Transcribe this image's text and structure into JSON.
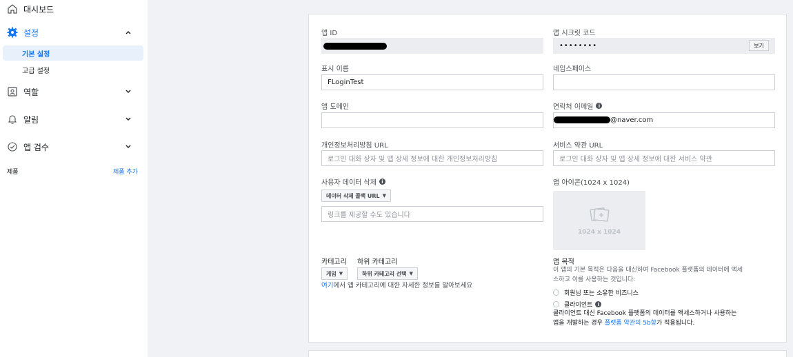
{
  "sidebar": {
    "dashboard": "대시보드",
    "settings": "설정",
    "settings_sub": {
      "basic": "기본 설정",
      "advanced": "고급 설정"
    },
    "roles": "역할",
    "alerts": "알림",
    "app_review": "앱 검수",
    "products_label": "제품",
    "add_product": "제품 추가"
  },
  "form": {
    "app_id_label": "앱 ID",
    "app_secret_label": "앱 시크릿 코드",
    "app_secret_value": "••••••••",
    "show_button": "보기",
    "display_name_label": "표시 이름",
    "display_name_value": "FLoginTest",
    "namespace_label": "네임스페이스",
    "namespace_value": "",
    "app_domain_label": "앱 도메인",
    "app_domain_value": "",
    "contact_email_label": "연락처 이메일",
    "contact_email_suffix": "@naver.com",
    "privacy_url_label": "개인정보처리방침 URL",
    "privacy_url_placeholder": "로그인 대화 상자 및 앱 상세 정보에 대한 개인정보처리방침",
    "tos_url_label": "서비스 약관 URL",
    "tos_url_placeholder": "로그인 대화 상자 및 앱 상세 정보에 대한 서비스 약관",
    "data_deletion_label": "사용자 데이터 삭제",
    "data_deletion_dropdown": "데이터 삭제 콜백 URL",
    "data_deletion_placeholder": "링크를 제공할 수도 있습니다",
    "app_icon_label": "앱 아이콘(1024 x 1024)",
    "app_icon_size": "1024 x 1024",
    "category_label": "카테고리",
    "subcategory_label": "하위 카테고리",
    "category_value": "게임",
    "subcategory_value": "하위 카테고리 선택",
    "category_help_link": "여기",
    "category_help_text": "에서 앱 카테고리에 대한 자세한 정보를 알아보세요",
    "app_purpose_label": "앱 목적",
    "app_purpose_desc_1": "이 앱의 기본 목적은 다음을 대신하여 Facebook 플랫폼의 데이터에 액세",
    "app_purpose_desc_2": "스하고 이를 사용하는 것입니다:",
    "purpose_option_1": "회원님 또는 소유한 비즈니스",
    "purpose_option_2": "클라이언트",
    "client_note_1": "클라이언트 대신 Facebook 플랫폼의 데이터를 액세스하거나 사용하는",
    "client_note_2a": "앱을 개발하는 경우 ",
    "client_note_2_link": "플랫폼 약관의 5b항",
    "client_note_2b": "가 적용됩니다."
  }
}
